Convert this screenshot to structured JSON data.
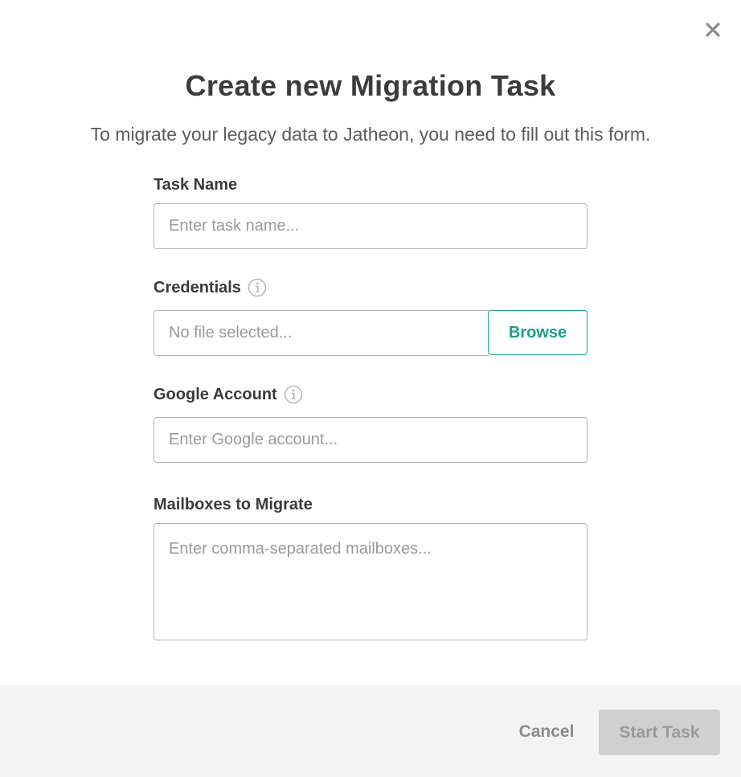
{
  "modal": {
    "title": "Create new Migration Task",
    "subtitle": "To migrate your legacy data to Jatheon, you need to fill out this form."
  },
  "form": {
    "task_name": {
      "label": "Task Name",
      "placeholder": "Enter task name...",
      "value": ""
    },
    "credentials": {
      "label": "Credentials",
      "info_icon": "info-circle-icon",
      "placeholder": "No file selected...",
      "browse_label": "Browse"
    },
    "google_account": {
      "label": "Google Account",
      "info_icon": "info-circle-icon",
      "placeholder": "Enter Google account...",
      "value": ""
    },
    "mailboxes": {
      "label": "Mailboxes to Migrate",
      "placeholder": "Enter comma-separated mailboxes...",
      "value": ""
    }
  },
  "footer": {
    "cancel_label": "Cancel",
    "start_label": "Start Task"
  },
  "colors": {
    "accent": "#17a08a",
    "footer_bg": "#f3f3f3",
    "disabled_button": "#d0d0d0"
  },
  "icons": {
    "close": "close-icon",
    "info": "info-circle-icon"
  }
}
